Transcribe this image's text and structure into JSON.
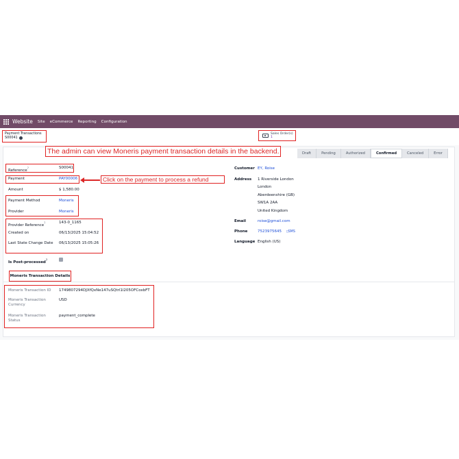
{
  "navbar": {
    "brand": "Website",
    "menu": [
      "Site",
      "eCommerce",
      "Reporting",
      "Configuration"
    ]
  },
  "breadcrumb": {
    "parent": "Payment Transactions",
    "record": "S00041"
  },
  "smart_button": {
    "label": "Sales Order(s)",
    "count": "1"
  },
  "annotations": {
    "banner": "The admin can view Moneris payment transaction details in the backend.",
    "callout": "Click on the payment to process a refund"
  },
  "status_stages": [
    "Draft",
    "Pending",
    "Authorized",
    "Confirmed",
    "Canceled",
    "Error"
  ],
  "active_stage": "Confirmed",
  "fields": {
    "reference": {
      "label": "Reference",
      "value": "S00041"
    },
    "payment": {
      "label": "Payment",
      "value": "PAY00006"
    },
    "amount": {
      "label": "Amount",
      "value": "$ 1,580.00"
    },
    "payment_method": {
      "label": "Payment Method",
      "value": "Moneris"
    },
    "provider": {
      "label": "Provider",
      "value": "Moneris"
    },
    "provider_reference": {
      "label": "Provider Reference",
      "value": "143-0_1165"
    },
    "created_on": {
      "label": "Created on",
      "value": "06/13/2025 15:04:52"
    },
    "last_state_change": {
      "label": "Last State Change Date",
      "value": "06/13/2025 15:05:26"
    },
    "is_post_processed": {
      "label": "Is Post-processed",
      "checked": true
    }
  },
  "customer": {
    "customer_label": "Customer",
    "customer_value": "EY, Roise",
    "address_label": "Address",
    "address_lines": [
      "1 Riverside London",
      "London",
      "Aberdeenshire (GB)",
      "SW1A 2AA",
      "United Kingdom"
    ],
    "email_label": "Email",
    "email_value": "roise@gmail.com",
    "phone_label": "Phone",
    "phone_value": "7523975645",
    "sms_label": "SMS",
    "language_label": "Language",
    "language_value": "English (US)"
  },
  "tab": {
    "label": "Moneris Transaction Details"
  },
  "moneris": {
    "transaction_id": {
      "label": "Moneris Transaction ID",
      "value": "1749807294DJXfQxNe147uSQtrl1l205OFCoxbFT"
    },
    "currency": {
      "label": "Moneris Transaction Currency",
      "value": "USD"
    },
    "status": {
      "label": "Moneris Transaction Status",
      "value": "payment_complete"
    }
  },
  "colors": {
    "navbar": "#714B67",
    "annotation": "#dc2626",
    "link": "#1d4ed8"
  }
}
